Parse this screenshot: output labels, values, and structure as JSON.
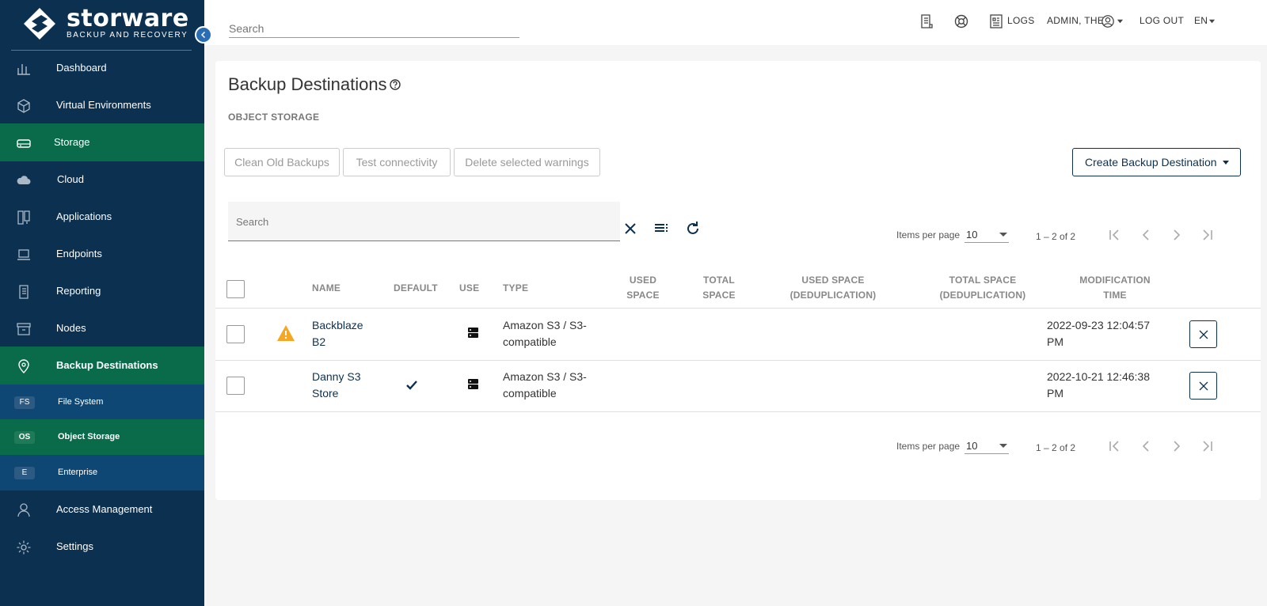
{
  "brand": {
    "name": "storware",
    "tagline": "BACKUP AND RECOVERY"
  },
  "sidebar": {
    "items": [
      {
        "label": "Dashboard",
        "icon": "bar-chart-icon"
      },
      {
        "label": "Virtual Environments",
        "icon": "cube-icon"
      },
      {
        "label": "Storage",
        "icon": "hard-drive-icon"
      },
      {
        "label": "Cloud",
        "icon": "cloud-icon"
      },
      {
        "label": "Applications",
        "icon": "applications-icon"
      },
      {
        "label": "Endpoints",
        "icon": "laptop-icon"
      },
      {
        "label": "Reporting",
        "icon": "report-icon"
      },
      {
        "label": "Nodes",
        "icon": "archive-box-icon"
      },
      {
        "label": "Backup Destinations",
        "icon": "location-pin-icon"
      },
      {
        "label": "Access Management",
        "icon": "user-icon"
      },
      {
        "label": "Settings",
        "icon": "gear-icon"
      }
    ],
    "subitems": [
      {
        "badge": "FS",
        "label": "File System"
      },
      {
        "badge": "OS",
        "label": "Object Storage"
      },
      {
        "badge": "E",
        "label": "Enterprise"
      }
    ]
  },
  "topbar": {
    "search_placeholder": "Search",
    "logs_label": "LOGS",
    "user_label": "ADMIN, THE",
    "logout_label": "LOG OUT",
    "lang_label": "EN"
  },
  "main": {
    "title": "Backup Destinations",
    "section": "OBJECT STORAGE",
    "buttons": {
      "clean": "Clean Old Backups",
      "test": "Test connectivity",
      "delete_warnings": "Delete selected warnings",
      "create": "Create Backup Destination"
    },
    "search_placeholder": "Search",
    "pager": {
      "items_per_page_label": "Items per page",
      "items_per_page": "10",
      "range": "1 – 2 of 2"
    },
    "table": {
      "headers": {
        "name": "NAME",
        "default": "DEFAULT",
        "use": "USE",
        "type": "TYPE",
        "used_space": [
          "USED",
          "SPACE"
        ],
        "total_space": [
          "TOTAL",
          "SPACE"
        ],
        "used_dedup": [
          "USED SPACE",
          "(DEDUPLICATION)"
        ],
        "total_dedup": [
          "TOTAL SPACE",
          "(DEDUPLICATION)"
        ],
        "mod_time": [
          "MODIFICATION",
          "TIME"
        ]
      },
      "rows": [
        {
          "name": [
            "Backblaze",
            "B2"
          ],
          "warning": true,
          "default": false,
          "type": [
            "Amazon S3 / S3-",
            "compatible"
          ],
          "mod_time": [
            "2022-09-23 12:04:57",
            "PM"
          ]
        },
        {
          "name": [
            "Danny S3",
            "Store"
          ],
          "warning": false,
          "default": true,
          "type": [
            "Amazon S3 / S3-",
            "compatible"
          ],
          "mod_time": [
            "2022-10-21 12:46:38",
            "PM"
          ]
        }
      ]
    }
  },
  "colors": {
    "sidebar": "#0c3050",
    "active": "#0a6b4a",
    "sub": "#0e4773",
    "warning": "#f5a623"
  }
}
